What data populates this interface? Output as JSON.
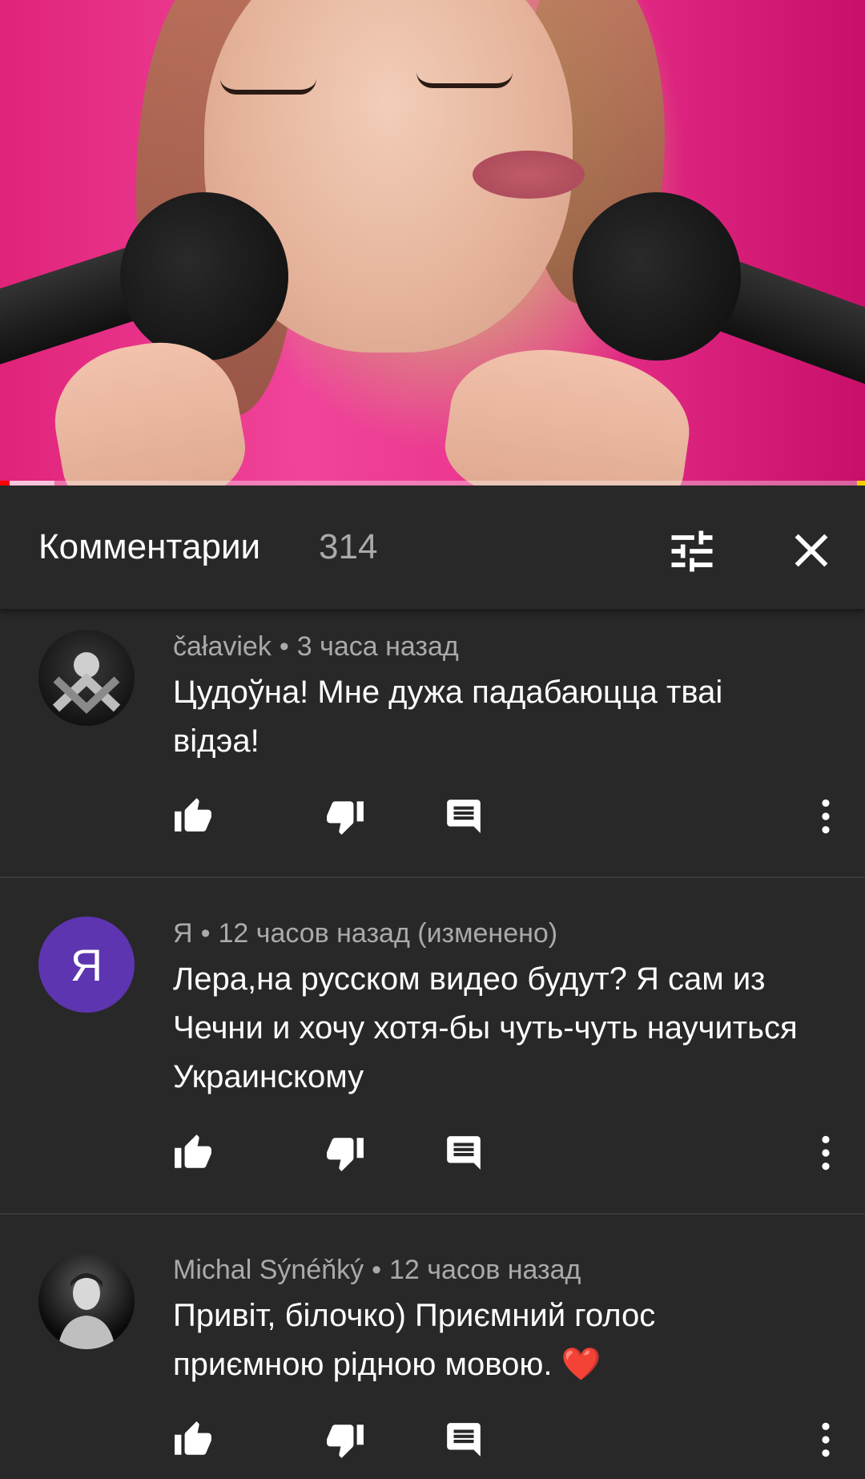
{
  "header": {
    "title": "Комментарии",
    "count": "314"
  },
  "player": {
    "progress_fraction": 0.0,
    "accent_color": "#ff0000"
  },
  "comments": [
    {
      "author": "čałaviek",
      "time": "3 часа назад",
      "text": "Цудоўна! Мне дужа падабаюцца тваі відэа!",
      "avatar": "photo"
    },
    {
      "author": "Я",
      "time": "12 часов назад (изменено)",
      "text": "Лера,на русском видео будут? Я сам из Чечни и хочу хотя-бы чуть-чуть научиться Украинскому",
      "avatar_letter": "Я",
      "avatar_color": "#5e35b1"
    },
    {
      "author": "Michal Sýnéňký",
      "time": "12 часов назад",
      "text": "Привіт, білочко) Приємний голос приємною рідною мовою. ❤️",
      "avatar": "photo"
    }
  ],
  "icons": {
    "sort": "sort-icon",
    "close": "close-icon",
    "like": "thumb-up-icon",
    "dislike": "thumb-down-icon",
    "reply": "reply-icon",
    "more": "more-vert-icon"
  }
}
